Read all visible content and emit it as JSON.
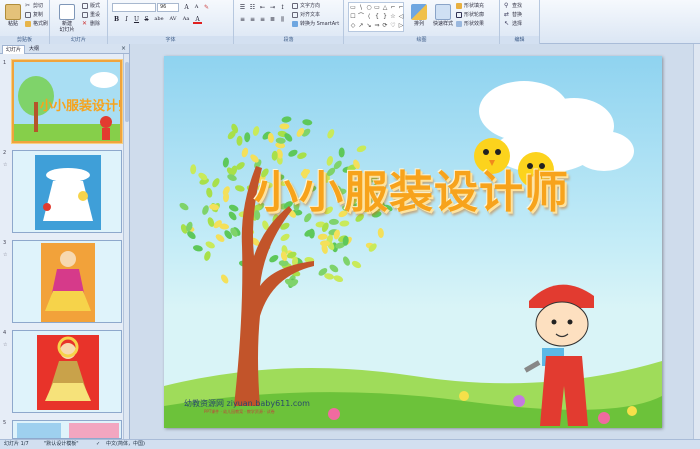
{
  "ribbon": {
    "clipboard": {
      "label": "剪贴板",
      "paste": "粘贴",
      "cut": "剪切",
      "copy": "复制",
      "format_painter": "格式刷"
    },
    "slides": {
      "label": "幻灯片",
      "new_slide": "新建\n幻灯片",
      "layout": "版式",
      "reset": "重设",
      "delete": "删除"
    },
    "font": {
      "label": "字体",
      "font_name": "",
      "font_size": "96",
      "bold": "B",
      "italic": "I",
      "underline": "U",
      "strike": "S",
      "shadow": "abe",
      "spacing": "AV",
      "case": "Aa",
      "color": "A"
    },
    "paragraph": {
      "label": "段落",
      "text_direction": "文字方向",
      "align_text": "对齐文本",
      "convert_smartart": "转换为 SmartArt"
    },
    "drawing": {
      "label": "绘图",
      "arrange": "排列",
      "quick_styles": "快速样式",
      "shape_fill": "形状填充",
      "shape_outline": "形状轮廓",
      "shape_effects": "形状效果",
      "shapes": [
        "▭",
        "\\",
        "○",
        "▭",
        "△",
        "⌐",
        "⌐",
        "☐",
        "⌒",
        "⟨",
        "{",
        "}",
        "☆",
        "◁",
        "◇",
        "↗",
        "↘",
        "⇒",
        "⟳",
        "♡",
        "▷"
      ]
    },
    "editing": {
      "label": "编辑",
      "find": "查找",
      "replace": "替换",
      "select": "选择"
    }
  },
  "left_panel": {
    "tab_slides": "幻灯片",
    "tab_outline": "大纲",
    "close": "×",
    "thumbs": [
      {
        "num": "1",
        "anim": ""
      },
      {
        "num": "2",
        "anim": "☆"
      },
      {
        "num": "3",
        "anim": "☆"
      },
      {
        "num": "4",
        "anim": "☆"
      },
      {
        "num": "5",
        "anim": ""
      }
    ]
  },
  "slide": {
    "title": "小小服装设计师",
    "watermark": "幼教资源网 ziyuan.baby611.com",
    "watermark_sub": "PPT课件 · 幼儿园教案 · 教学资源 · 试卷"
  },
  "statusbar": {
    "slide_counter": "幻灯片 1/7",
    "theme": "\"默认设计模板\"",
    "language": "中文(简体，中国)"
  },
  "colors": {
    "title": "#f7a31c",
    "sky_top": "#8fd3f0",
    "grass": "#7cc83c",
    "selection_border": "#f0a43c"
  }
}
